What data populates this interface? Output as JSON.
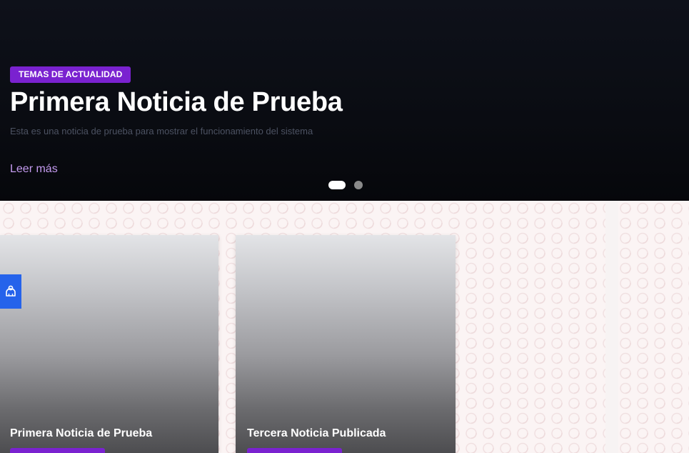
{
  "hero": {
    "badge": "TEMAS DE ACTUALIDAD",
    "title": "Primera Noticia de Prueba",
    "description": "Esta es una noticia de prueba para mostrar el funcionamiento del sistema",
    "link": "Leer más",
    "slides": {
      "count": 2,
      "active": 1
    }
  },
  "cards": [
    {
      "title": "Primera Noticia de Prueba"
    },
    {
      "title": "Tercera Noticia Publicada"
    }
  ],
  "accessibility": {
    "icon": "accessibility-icon"
  },
  "colors": {
    "accent": "#7a22d0",
    "link": "#c49bf0",
    "a11y": "#2563eb",
    "hero_bg": "#0b0e15"
  }
}
